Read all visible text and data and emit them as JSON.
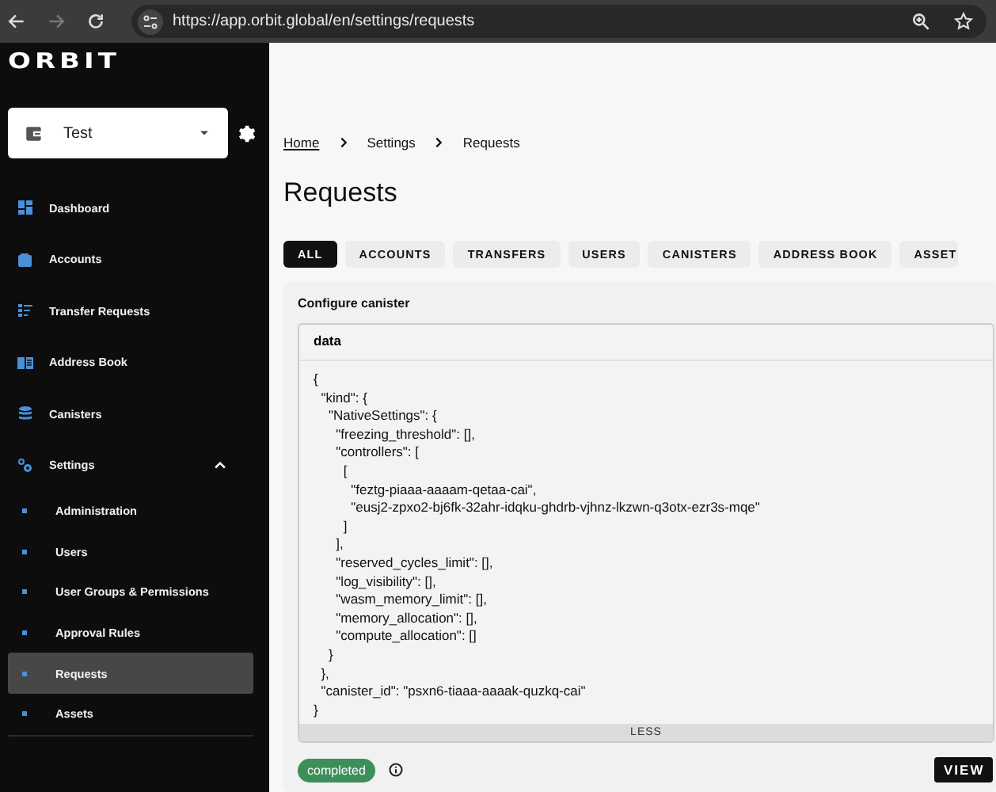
{
  "browser": {
    "url": "https://app.orbit.global/en/settings/requests",
    "forward_disabled": true
  },
  "sidebar": {
    "logo": "ORBIT",
    "station": "Test",
    "items": [
      {
        "label": "Dashboard",
        "selected": false
      },
      {
        "label": "Accounts",
        "selected": false
      },
      {
        "label": "Transfer Requests",
        "selected": false
      },
      {
        "label": "Address Book",
        "selected": false
      },
      {
        "label": "Canisters",
        "selected": false
      },
      {
        "label": "Settings",
        "selected": false,
        "expanded": true,
        "children": [
          {
            "label": "Administration",
            "selected": false
          },
          {
            "label": "Users",
            "selected": false
          },
          {
            "label": "User Groups & Permissions",
            "selected": false
          },
          {
            "label": "Approval Rules",
            "selected": false
          },
          {
            "label": "Requests",
            "selected": true
          },
          {
            "label": "Assets",
            "selected": false
          }
        ]
      }
    ]
  },
  "breadcrumbs": [
    {
      "label": "Home",
      "link": true
    },
    {
      "label": "Settings",
      "link": false
    },
    {
      "label": "Requests",
      "link": false
    }
  ],
  "title": "Requests",
  "tabs": [
    {
      "label": "ALL",
      "selected": true
    },
    {
      "label": "ACCOUNTS",
      "selected": false
    },
    {
      "label": "TRANSFERS",
      "selected": false
    },
    {
      "label": "USERS",
      "selected": false
    },
    {
      "label": "CANISTERS",
      "selected": false
    },
    {
      "label": "ADDRESS BOOK",
      "selected": false
    },
    {
      "label": "ASSET",
      "selected": false
    }
  ],
  "request": {
    "title": "Configure canister",
    "data_label": "data",
    "code_lines": [
      "{",
      "  \"kind\": {",
      "    \"NativeSettings\": {",
      "      \"freezing_threshold\": [],",
      "      \"controllers\": [",
      "        [",
      "          \"feztg-piaaa-aaaam-qetaa-cai\",",
      "          \"eusj2-zpxo2-bj6fk-32ahr-idqku-ghdrb-vjhnz-lkzwn-q3otx-ezr3s-mqe\"",
      "        ]",
      "      ],",
      "      \"reserved_cycles_limit\": [],",
      "      \"log_visibility\": [],",
      "      \"wasm_memory_limit\": [],",
      "      \"memory_allocation\": [],",
      "      \"compute_allocation\": []",
      "    }",
      "  },",
      "  \"canister_id\": \"psxn6-tiaaa-aaaak-quzkq-cai\"",
      "}"
    ],
    "toggle": "LESS",
    "status": "completed",
    "action": "VIEW"
  }
}
